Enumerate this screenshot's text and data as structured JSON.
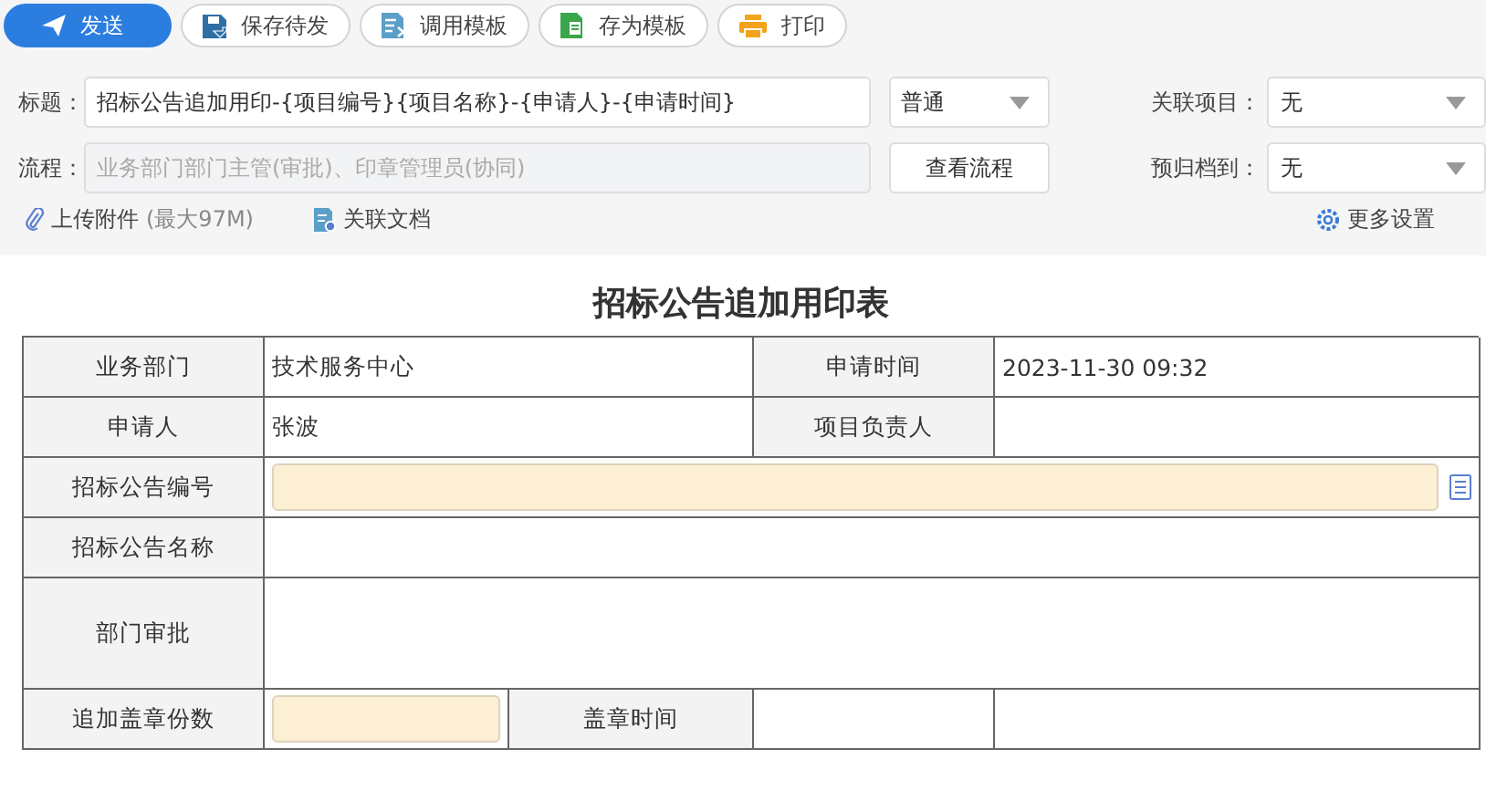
{
  "toolbar": [
    {
      "label": "发送",
      "kind": "send",
      "primary": true
    },
    {
      "label": "保存待发",
      "kind": "save",
      "primary": false
    },
    {
      "label": "调用模板",
      "kind": "use-template",
      "primary": false
    },
    {
      "label": "存为模板",
      "kind": "save-template",
      "primary": false
    },
    {
      "label": "打印",
      "kind": "print",
      "primary": false
    }
  ],
  "header": {
    "title_label": "标题：",
    "title_value": "招标公告追加用印-{项目编号}{项目名称}-{申请人}-{申请时间}",
    "priority": "普通",
    "project_label": "关联项目：",
    "project_value": "无",
    "flow_label": "流程：",
    "flow_placeholder": "业务部门部门主管(审批)、印章管理员(协同)",
    "flow_button": "查看流程",
    "archive_label": "预归档到：",
    "archive_value": "无",
    "attach": "上传附件",
    "attach_limit": "(最大97M)",
    "related_docs": "关联文档",
    "more_settings": "更多设置"
  },
  "form": {
    "title": "招标公告追加用印表",
    "rows": [
      {
        "kind": "pair",
        "cells": [
          {
            "kind": "label",
            "text": "业务部门"
          },
          {
            "kind": "value",
            "text": "技术服务中心"
          },
          {
            "kind": "label",
            "text": "申请时间"
          },
          {
            "kind": "value",
            "text": "2023-11-30 09:32"
          }
        ]
      },
      {
        "kind": "pair",
        "cells": [
          {
            "kind": "label",
            "text": "申请人"
          },
          {
            "kind": "value",
            "text": "张波"
          },
          {
            "kind": "label",
            "text": "项目负责人"
          },
          {
            "kind": "value"
          }
        ]
      },
      {
        "kind": "wide",
        "cells": [
          {
            "kind": "label",
            "text": "招标公告编号"
          },
          {
            "kind": "picker"
          }
        ]
      },
      {
        "kind": "wide",
        "cells": [
          {
            "kind": "label",
            "text": "招标公告名称"
          },
          {
            "kind": "value"
          }
        ]
      },
      {
        "kind": "tall",
        "cells": [
          {
            "kind": "label",
            "text": "部门审批"
          },
          {
            "kind": "value"
          }
        ]
      },
      {
        "kind": "mixed",
        "cells": [
          {
            "kind": "label",
            "text": "追加盖章份数"
          },
          {
            "kind": "input"
          },
          {
            "kind": "label",
            "text": "盖章时间"
          },
          {
            "kind": "value"
          },
          {
            "kind": "value"
          }
        ]
      }
    ]
  }
}
